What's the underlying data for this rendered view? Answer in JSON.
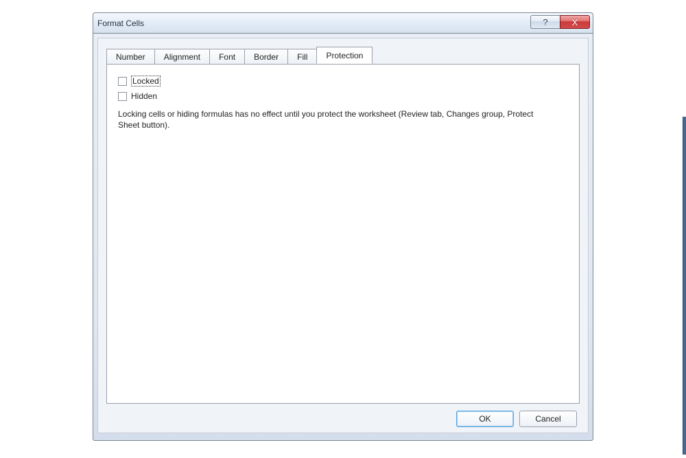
{
  "window": {
    "title": "Format Cells",
    "help_glyph": "?",
    "close_glyph": "X"
  },
  "tabs": {
    "number": "Number",
    "alignment": "Alignment",
    "font": "Font",
    "border": "Border",
    "fill": "Fill",
    "protection": "Protection",
    "active": "protection"
  },
  "protection": {
    "locked_label": "Locked",
    "hidden_label": "Hidden",
    "locked_checked": false,
    "hidden_checked": false,
    "note": "Locking cells or hiding formulas has no effect until you protect the worksheet (Review tab, Changes group, Protect Sheet button)."
  },
  "buttons": {
    "ok": "OK",
    "cancel": "Cancel"
  }
}
